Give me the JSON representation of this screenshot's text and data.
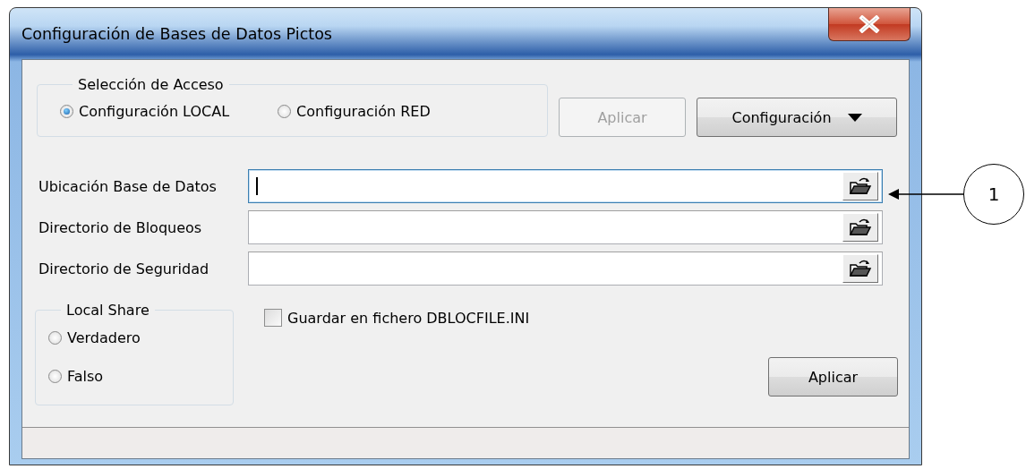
{
  "window": {
    "title": "Configuración de Bases de Datos Pictos"
  },
  "access_group": {
    "legend": "Selección de Acceso",
    "options": [
      {
        "label": "Configuración LOCAL",
        "selected": true
      },
      {
        "label": "Configuración RED",
        "selected": false
      }
    ]
  },
  "top_buttons": [
    {
      "label": "Aplicar",
      "disabled": true,
      "kind": "plain"
    },
    {
      "label": "Configuración",
      "disabled": false,
      "kind": "dropdown"
    }
  ],
  "fields": [
    {
      "label": "Ubicación Base de Datos",
      "focused": true
    },
    {
      "label": "Directorio de Bloqueos",
      "focused": false
    },
    {
      "label": "Directorio de Seguridad",
      "focused": false
    }
  ],
  "local_share": {
    "legend": "Local Share",
    "options": [
      {
        "label": "Verdadero",
        "selected": false
      },
      {
        "label": "Falso",
        "selected": false
      }
    ]
  },
  "save_checkbox": {
    "label": "Guardar en fichero DBLOCFILE.INI",
    "checked": false
  },
  "apply_button": {
    "label": "Aplicar",
    "disabled": false
  },
  "callout": {
    "label": "1"
  }
}
